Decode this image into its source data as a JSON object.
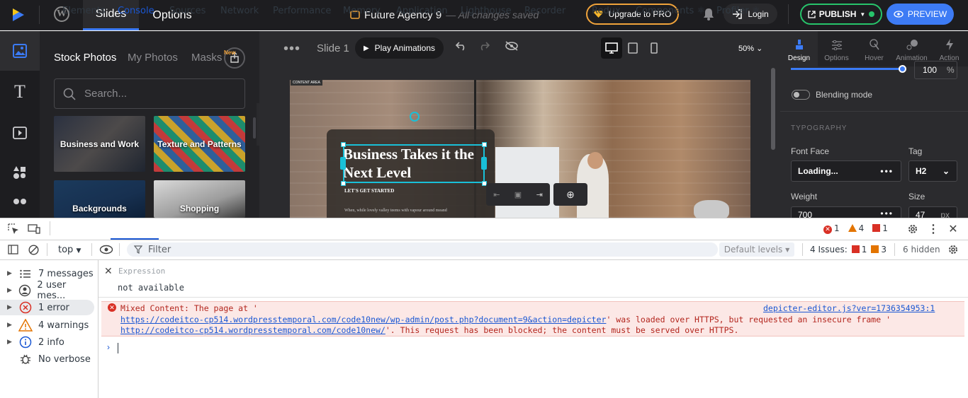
{
  "topbar": {
    "tab_slides": "Slides",
    "tab_options": "Options",
    "doc_title": "Future Agency 9",
    "doc_status": "— All changes saved",
    "upgrade": "Upgrade to PRO",
    "login": "Login",
    "publish": "PUBLISH",
    "preview": "PREVIEW",
    "brand_color": "#3b7bf6"
  },
  "panel": {
    "tabs": [
      "Stock Photos",
      "My Photos",
      "Masks"
    ],
    "new_badge": "New",
    "search_placeholder": "Search...",
    "tiles": [
      "Business and Work",
      "Texture and Patterns",
      "Backgrounds",
      "Shopping"
    ]
  },
  "canvas": {
    "slide_label": "Slide 1",
    "play": "Play Animations",
    "zoom": "50%",
    "content_area": "CONTENT AREA",
    "heading": "Business Takes it the Next Level",
    "subheading": "LET'S GET STARTED",
    "body": "When, while lovely valley teems with vapour around meand"
  },
  "right": {
    "tabs": [
      "Design",
      "Options",
      "Hover",
      "Animation",
      "Action"
    ],
    "opacity": "100",
    "opacity_unit": "%",
    "blending": "Blending mode",
    "typography": "TYPOGRAPHY",
    "font_face_label": "Font Face",
    "font_face_value": "Loading...",
    "tag_label": "Tag",
    "tag_value": "H2",
    "weight_label": "Weight",
    "weight_value": "700",
    "size_label": "Size",
    "size_value": "47",
    "size_unit": "px"
  },
  "devtools": {
    "tabs": [
      "Elements",
      "Console",
      "Sources",
      "Network",
      "Performance",
      "Memory",
      "Application",
      "Lighthouse",
      "Recorder",
      "Redux",
      "Components ⚛",
      "Profiler ⚛"
    ],
    "counts": {
      "errors": "1",
      "warnings": "4",
      "issues_flag": "1"
    },
    "context": "top",
    "filter_placeholder": "Filter",
    "levels": "Default levels",
    "issues_label": "4 Issues:",
    "issues_red": "1",
    "issues_orange": "3",
    "hidden": "6 hidden",
    "sidebar": [
      "7 messages",
      "2 user mes...",
      "1 error",
      "4 warnings",
      "2 info",
      "No verbose"
    ],
    "expression_label": "Expression",
    "expression_value": "not available",
    "error_prefix": "Mixed Content: The page at '",
    "error_url1": "https://codeitco-cp514.wordpresstemporal.com/code10new/wp-admin/post.php?document=9&action=depicter",
    "error_mid": "' was loaded over HTTPS, but requested an insecure frame '",
    "error_url2": "http://codeitco-cp514.wordpresstemporal.com/code10new/",
    "error_end": "'. This request has been blocked; the content must be served over HTTPS.",
    "error_source": "depicter-editor.js?ver=1736354953:1"
  }
}
